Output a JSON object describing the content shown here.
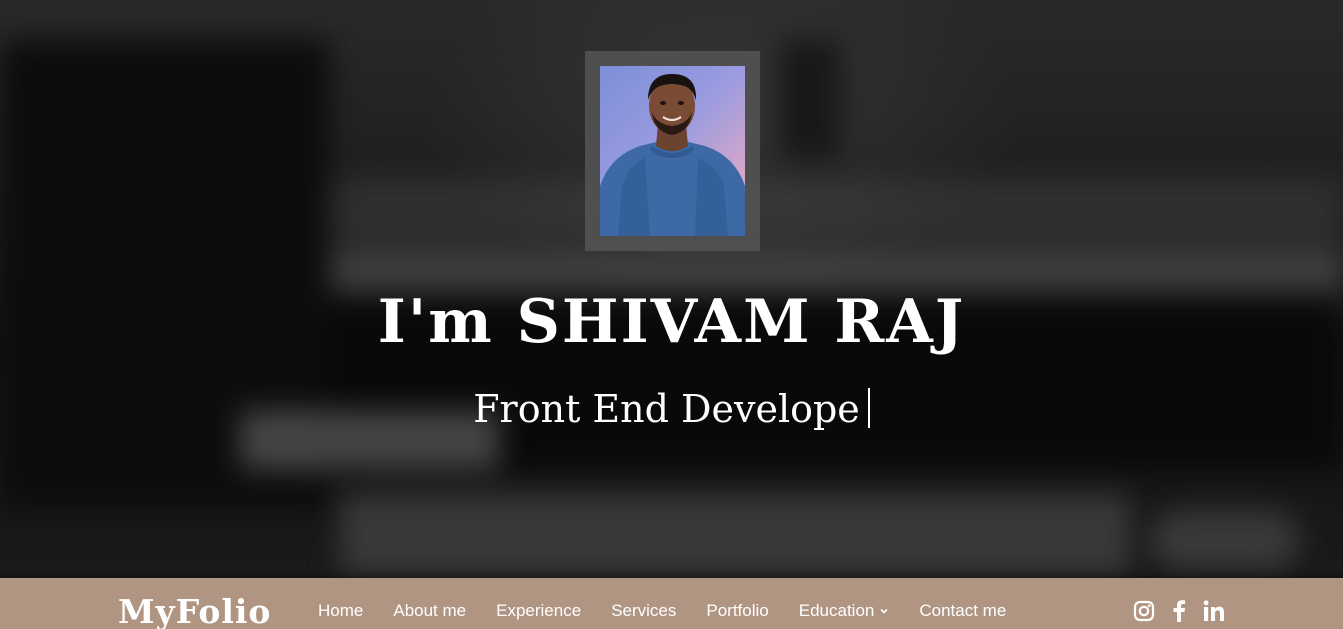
{
  "hero": {
    "title": "I'm SHIVAM RAJ",
    "subtitle": "Front End Develope"
  },
  "navbar": {
    "logo": "MyFolio",
    "items": [
      {
        "label": "Home"
      },
      {
        "label": "About me"
      },
      {
        "label": "Experience"
      },
      {
        "label": "Services"
      },
      {
        "label": "Portfolio"
      },
      {
        "label": "Education",
        "has_dropdown": true
      },
      {
        "label": "Contact me"
      }
    ],
    "social_icons": [
      "instagram-icon",
      "facebook-icon",
      "linkedin-icon"
    ]
  },
  "colors": {
    "navbar_bg": "#b19583",
    "text": "#ffffff"
  }
}
